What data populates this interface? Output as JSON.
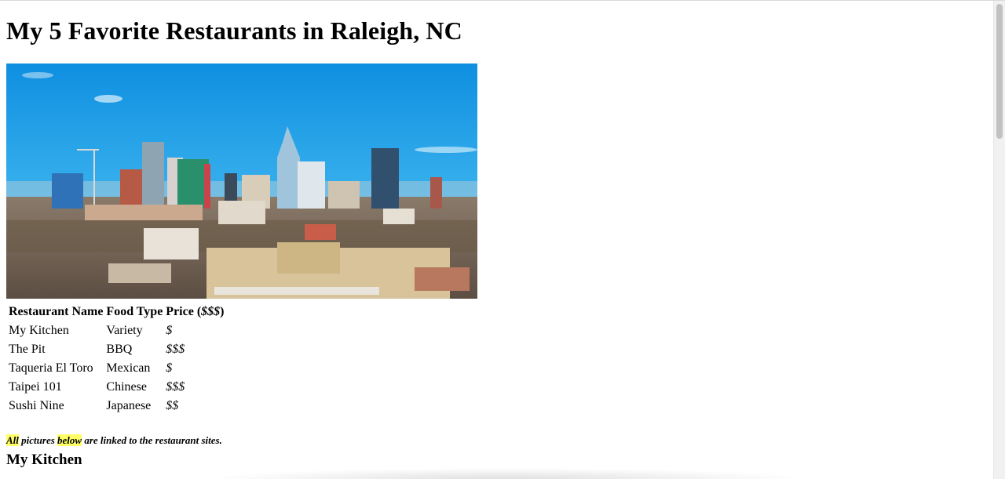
{
  "page": {
    "title": "My 5 Favorite Restaurants in Raleigh, NC",
    "hero_alt": "Raleigh skyline"
  },
  "table": {
    "headers": [
      "Restaurant Name",
      "Food Type",
      "Price ($$$)"
    ],
    "rows": [
      {
        "name": "My Kitchen",
        "type": "Variety",
        "price": "$"
      },
      {
        "name": "The Pit",
        "type": "BBQ",
        "price": "$$$"
      },
      {
        "name": "Taqueria El Toro",
        "type": "Mexican",
        "price": "$"
      },
      {
        "name": "Taipei 101",
        "type": "Chinese",
        "price": "$$$"
      },
      {
        "name": "Sushi Nine",
        "type": "Japanese",
        "price": "$$"
      }
    ]
  },
  "note": {
    "word1": "All",
    "text1": " pictures ",
    "word2": "below",
    "text2": " are linked to the restaurant sites."
  },
  "section": {
    "first_heading": "My Kitchen"
  },
  "colors": {
    "highlight": "#ffff66",
    "sky": "#1aa0e6"
  }
}
